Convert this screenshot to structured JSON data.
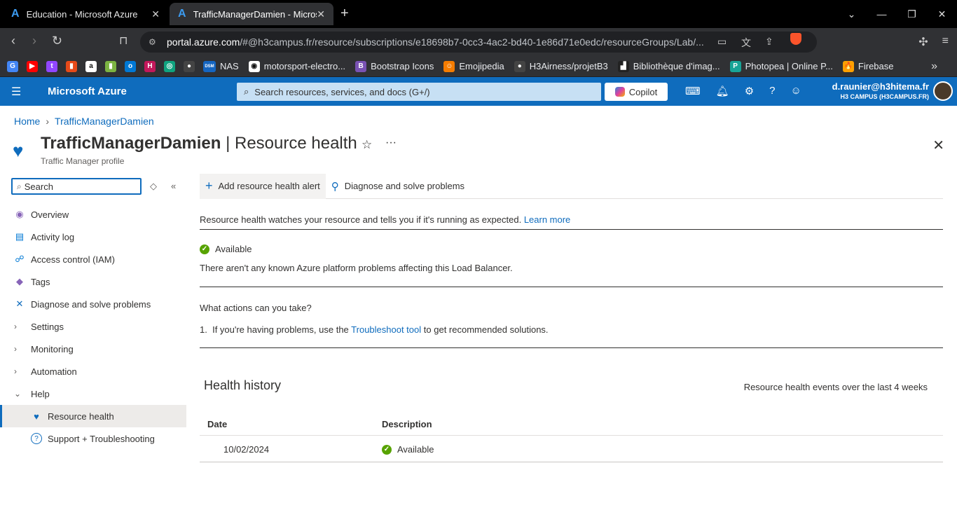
{
  "browser": {
    "tabs": [
      {
        "title": "Education - Microsoft Azure",
        "active": false
      },
      {
        "title": "TrafficManagerDamien - Microsoft Azure",
        "active": true
      }
    ],
    "url_host": "portal.azure.com",
    "url_rest": "/#@h3campus.fr/resource/subscriptions/e18698b7-0cc3-4ac2-bd40-1e86d71e0edc/resourceGroups/Lab/..."
  },
  "bookmarks": [
    {
      "label": "",
      "icon": "google-icon",
      "color": "#4285f4",
      "glyph": "G"
    },
    {
      "label": "",
      "icon": "youtube-icon",
      "color": "#ff0000",
      "glyph": "▶"
    },
    {
      "label": "",
      "icon": "twitch-icon",
      "color": "#9146ff",
      "glyph": "t"
    },
    {
      "label": "",
      "icon": "bookmark-app-icon",
      "color": "#e64a19",
      "glyph": "▮"
    },
    {
      "label": "",
      "icon": "amazon-icon",
      "color": "#ffffff",
      "glyph": "a"
    },
    {
      "label": "",
      "icon": "bookmark-app-icon",
      "color": "#7cb342",
      "glyph": "▮"
    },
    {
      "label": "",
      "icon": "outlook-icon",
      "color": "#0078d4",
      "glyph": "o"
    },
    {
      "label": "",
      "icon": "h3-icon",
      "color": "#c2185b",
      "glyph": "H"
    },
    {
      "label": "",
      "icon": "chatgpt-icon",
      "color": "#10a37f",
      "glyph": "◎"
    },
    {
      "label": "",
      "icon": "github-icon",
      "color": "#444444",
      "glyph": "●"
    },
    {
      "label": "NAS",
      "icon": "dsm-icon",
      "color": "#1565c0",
      "glyph": "DSM"
    },
    {
      "label": "motorsport-electro...",
      "icon": "globe-icon",
      "color": "#ffffff",
      "glyph": "◉"
    },
    {
      "label": "Bootstrap Icons",
      "icon": "bootstrap-icon",
      "color": "#7952b3",
      "glyph": "B"
    },
    {
      "label": "Emojipedia",
      "icon": "emojipedia-icon",
      "color": "#f57c00",
      "glyph": "☺"
    },
    {
      "label": "H3Airness/projetB3",
      "icon": "github-icon",
      "color": "#444444",
      "glyph": "●"
    },
    {
      "label": "Bibliothèque d'imag...",
      "icon": "library-icon",
      "color": "#222222",
      "glyph": "▟"
    },
    {
      "label": "Photopea | Online P...",
      "icon": "photopea-icon",
      "color": "#18a497",
      "glyph": "P"
    },
    {
      "label": "Firebase",
      "icon": "firebase-icon",
      "color": "#ffa000",
      "glyph": "🔥"
    }
  ],
  "azure": {
    "brand": "Microsoft Azure",
    "search_placeholder": "Search resources, services, and docs (G+/)",
    "copilot": "Copilot",
    "user_email": "d.raunier@h3hitema.fr",
    "user_org": "H3 CAMPUS (H3CAMPUS.FR)"
  },
  "breadcrumb": {
    "home": "Home",
    "resource": "TrafficManagerDamien"
  },
  "page": {
    "resource_name": "TrafficManagerDamien",
    "section": "| Resource health",
    "subtitle": "Traffic Manager profile"
  },
  "sidebar": {
    "search_placeholder": "Search",
    "items": [
      {
        "label": "Overview",
        "icon": "overview-icon"
      },
      {
        "label": "Activity log",
        "icon": "activity-log-icon"
      },
      {
        "label": "Access control (IAM)",
        "icon": "iam-icon"
      },
      {
        "label": "Tags",
        "icon": "tag-icon"
      },
      {
        "label": "Diagnose and solve problems",
        "icon": "wrench-icon"
      },
      {
        "label": "Settings",
        "icon": "chevron-right-icon"
      },
      {
        "label": "Monitoring",
        "icon": "chevron-right-icon"
      },
      {
        "label": "Automation",
        "icon": "chevron-right-icon"
      },
      {
        "label": "Help",
        "icon": "chevron-down-icon"
      },
      {
        "label": "Resource health",
        "icon": "heart-pulse-icon"
      },
      {
        "label": "Support + Troubleshooting",
        "icon": "help-circle-icon"
      }
    ]
  },
  "commands": {
    "add_alert": "Add resource health alert",
    "diagnose": "Diagnose and solve problems"
  },
  "main": {
    "intro": "Resource health watches your resource and tells you if it's running as expected.",
    "learn_more": "Learn more",
    "status": "Available",
    "status_desc": "There aren't any known Azure platform problems affecting this Load Balancer.",
    "actions_q": "What actions can you take?",
    "action1_num": "1.",
    "action1_pre": "If you're having problems, use the",
    "action1_link": "Troubleshoot tool",
    "action1_post": "to get recommended solutions.",
    "history_title": "Health history",
    "history_sub": "Resource health events over the last 4 weeks",
    "col_date": "Date",
    "col_desc": "Description",
    "rows": [
      {
        "date": "10/02/2024",
        "description": "Available"
      }
    ]
  }
}
